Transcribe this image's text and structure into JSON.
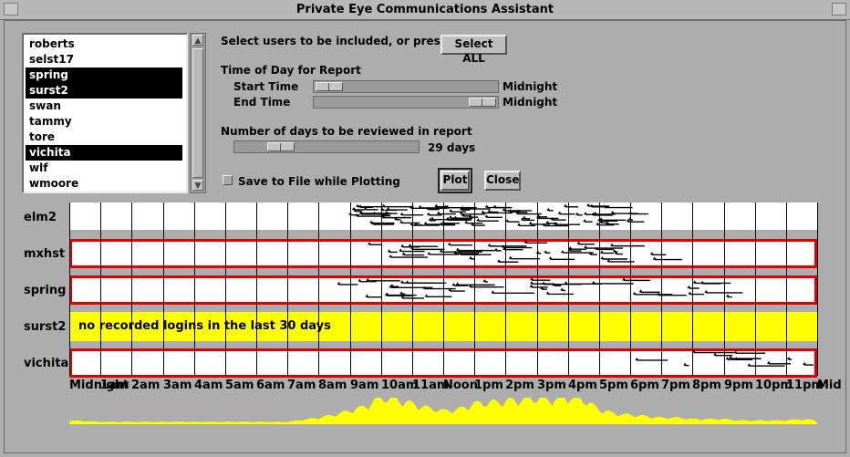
{
  "window": {
    "title": "Private Eye Communications Assistant"
  },
  "users": [
    {
      "name": "roberts",
      "selected": false
    },
    {
      "name": "selst17",
      "selected": false
    },
    {
      "name": "spring",
      "selected": true
    },
    {
      "name": "surst2",
      "selected": true
    },
    {
      "name": "swan",
      "selected": false
    },
    {
      "name": "tammy",
      "selected": false
    },
    {
      "name": "tore",
      "selected": false
    },
    {
      "name": "vichita",
      "selected": true
    },
    {
      "name": "wlf",
      "selected": false
    },
    {
      "name": "wmoore",
      "selected": false
    }
  ],
  "controls": {
    "select_prompt": "Select users to be included, or press to",
    "select_all_label": "Select ALL",
    "time_heading": "Time of Day for Report",
    "start_label": "Start Time",
    "start_value": "Midnight",
    "start_fraction": 0.0,
    "end_label": "End Time",
    "end_value": "Midnight",
    "end_fraction": 1.0,
    "days_heading": "Number of days to be reviewed in report",
    "days_value": "29 days",
    "days_fraction": 0.2,
    "save_label": "Save to File while Plotting",
    "save_checked": false,
    "plot_label": "Plot",
    "close_label": "Close"
  },
  "colors": {
    "highlight_border": "#e00000",
    "no_data": "#ffff00",
    "activity_mark": "#000000",
    "histogram": "#ffff00"
  },
  "rows": [
    {
      "user": "elm2",
      "highlight": false,
      "no_data_text": ""
    },
    {
      "user": "mxhst",
      "highlight": true,
      "no_data_text": ""
    },
    {
      "user": "spring",
      "highlight": true,
      "no_data_text": ""
    },
    {
      "user": "surst2",
      "highlight": false,
      "no_data_text": "no recorded logins in the last 30 days"
    },
    {
      "user": "vichita",
      "highlight": true,
      "no_data_text": ""
    }
  ],
  "time_ticks": [
    "Midnight",
    "1am",
    "2am",
    "3am",
    "4am",
    "5am",
    "6am",
    "7am",
    "8am",
    "9am",
    "10am",
    "11am",
    "Noon",
    "1pm",
    "2pm",
    "3pm",
    "4pm",
    "5pm",
    "6pm",
    "7pm",
    "8pm",
    "9pm",
    "10pm",
    "11pm",
    "Mid"
  ],
  "chart_data": {
    "type": "area",
    "xlabel": "",
    "ylabel": "",
    "x_range_hours": [
      0,
      24
    ],
    "series": [
      {
        "x": [
          0,
          1,
          2,
          3,
          4,
          5,
          6,
          7,
          8,
          8.5,
          9,
          9.5,
          10,
          10.5,
          11,
          11.5,
          12,
          12.5,
          13,
          13.5,
          14,
          14.5,
          15,
          15.5,
          16,
          16.5,
          17,
          17.5,
          18,
          18.5,
          19,
          19.5,
          20,
          20.5,
          21,
          21.5,
          22,
          22.5,
          23,
          23.5,
          24
        ],
        "values": [
          0.1,
          0.05,
          0.05,
          0.05,
          0.05,
          0.05,
          0.05,
          0.05,
          0.2,
          0.3,
          0.45,
          0.6,
          0.95,
          0.85,
          0.7,
          0.55,
          0.45,
          0.5,
          0.7,
          0.75,
          0.8,
          0.85,
          0.9,
          0.85,
          0.95,
          0.85,
          0.5,
          0.35,
          0.3,
          0.25,
          0.2,
          0.2,
          0.15,
          0.15,
          0.15,
          0.1,
          0.1,
          0.1,
          0.1,
          0.15,
          0.1
        ]
      }
    ]
  }
}
